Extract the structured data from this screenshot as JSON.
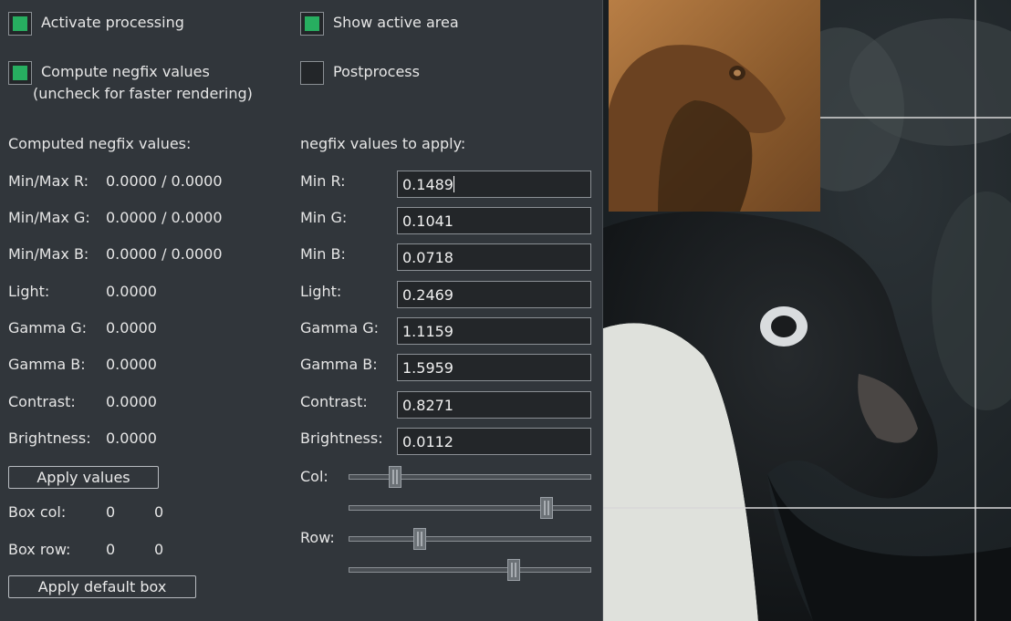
{
  "checkboxes": {
    "activate_processing": {
      "label": "Activate processing",
      "checked": true
    },
    "show_active_area": {
      "label": "Show active area",
      "checked": true
    },
    "compute_negfix": {
      "label_line1": "Compute negfix values",
      "label_line2": "(uncheck for faster rendering)",
      "checked": true
    },
    "postprocess": {
      "label": "Postprocess",
      "checked": false
    }
  },
  "computed": {
    "heading": "Computed negfix values:",
    "rows": [
      {
        "label": "Min/Max R:",
        "value": "0.0000 / 0.0000"
      },
      {
        "label": "Min/Max G:",
        "value": "0.0000 / 0.0000"
      },
      {
        "label": "Min/Max B:",
        "value": "0.0000 / 0.0000"
      },
      {
        "label": "Light:",
        "value": "0.0000"
      },
      {
        "label": "Gamma G:",
        "value": "0.0000"
      },
      {
        "label": "Gamma B:",
        "value": "0.0000"
      },
      {
        "label": "Contrast:",
        "value": "0.0000"
      },
      {
        "label": "Brightness:",
        "value": "0.0000"
      }
    ],
    "apply_button": "Apply values",
    "box_col": {
      "label": "Box col:",
      "v1": "0",
      "v2": "0"
    },
    "box_row": {
      "label": "Box row:",
      "v1": "0",
      "v2": "0"
    },
    "default_box_button": "Apply default box"
  },
  "apply": {
    "heading": "negfix values to apply:",
    "fields": [
      {
        "label": "Min R:",
        "value": "0.1489"
      },
      {
        "label": "Min G:",
        "value": "0.1041"
      },
      {
        "label": "Min B:",
        "value": "0.0718"
      },
      {
        "label": "Light:",
        "value": "0.2469"
      },
      {
        "label": "Gamma G:",
        "value": "1.1159"
      },
      {
        "label": "Gamma B:",
        "value": "1.5959"
      },
      {
        "label": "Contrast:",
        "value": "0.8271"
      },
      {
        "label": "Brightness:",
        "value": "0.0112"
      }
    ],
    "col_label": "Col:",
    "row_label": "Row:",
    "sliders": {
      "col_start": 0.19,
      "col_end": 0.82,
      "row_start": 0.29,
      "row_end": 0.68
    }
  },
  "colors": {
    "accent": "#27ae60",
    "panel": "#31363b",
    "input_bg": "#232629"
  },
  "icons": {
    "checkbox": "checkbox-icon",
    "slider": "slider-handle-icon"
  }
}
